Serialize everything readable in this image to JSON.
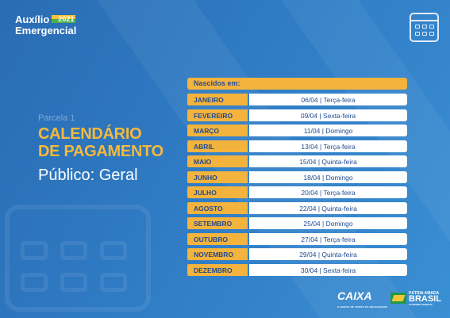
{
  "brand": {
    "line1": "Auxílio",
    "year": "2021",
    "line2": "Emergencial"
  },
  "left": {
    "parcela": "Parcela 1",
    "title_line1": "CALENDÁRIO",
    "title_line2": "DE PAGAMENTO",
    "publico": "Público: Geral"
  },
  "table": {
    "header": "Nascidos em:",
    "rows": [
      {
        "month": "JANEIRO",
        "date": "06/04 | Terça-feira"
      },
      {
        "month": "FEVEREIRO",
        "date": "09/04 | Sexta-feira"
      },
      {
        "month": "MARÇO",
        "date": "11/04 | Domingo"
      },
      {
        "month": "ABRIL",
        "date": "13/04 | Terça-feira"
      },
      {
        "month": "MAIO",
        "date": "15/04 | Quinta-feira"
      },
      {
        "month": "JUNHO",
        "date": "18/04 | Domingo"
      },
      {
        "month": "JULHO",
        "date": "20/04 | Terça-feira"
      },
      {
        "month": "AGOSTO",
        "date": "22/04 | Quinta-feira"
      },
      {
        "month": "SETEMBRO",
        "date": "25/04 | Domingo"
      },
      {
        "month": "OUTUBRO",
        "date": "27/04 | Terça-feira"
      },
      {
        "month": "NOVEMBRO",
        "date": "29/04 | Quinta-feira"
      },
      {
        "month": "DEZEMBRO",
        "date": "30/04 | Sexta-feira"
      }
    ]
  },
  "footer": {
    "caixa": "CAIXA",
    "caixa_tagline": "O BANCO DE TODOS OS BRASILEIROS",
    "gov_line1": "PÁTRIA AMADA",
    "gov_line2": "BRASIL",
    "gov_line3": "GOVERNO FEDERAL"
  },
  "colors": {
    "background": "#2f7bc4",
    "accent": "#f3b33d",
    "text_dark": "#1f4a90"
  }
}
